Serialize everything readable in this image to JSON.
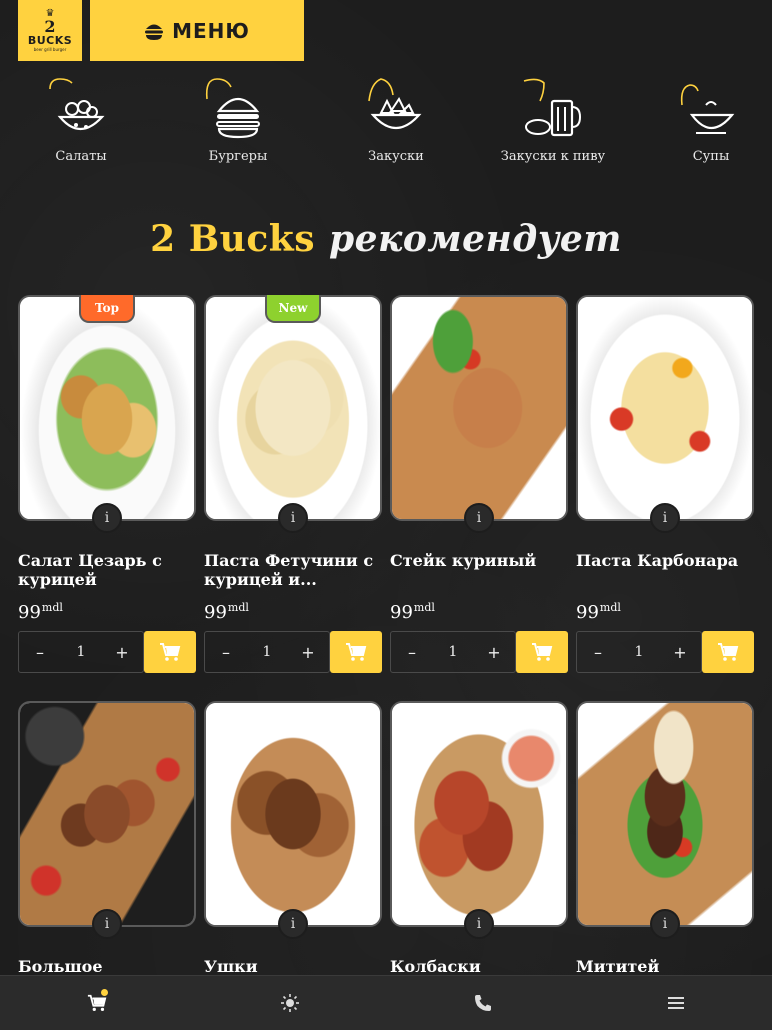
{
  "header": {
    "logo": {
      "line1": "2",
      "line2": "BUCKS",
      "line3": "beer grill burger"
    },
    "menu_label": "МЕНЮ"
  },
  "categories": [
    {
      "label": "Салаты",
      "icon": "salad-bowl-icon"
    },
    {
      "label": "Бургеры",
      "icon": "burger-icon"
    },
    {
      "label": "Закуски",
      "icon": "snacks-bowl-icon"
    },
    {
      "label": "Закуски к пиву",
      "icon": "beer-snacks-icon"
    },
    {
      "label": "Супы",
      "icon": "soup-bowl-icon"
    }
  ],
  "section": {
    "brand": "2 Bucks",
    "title": "рекомендует"
  },
  "products": [
    {
      "name": "Салат Цезарь с курицей",
      "price": "99",
      "currency": "mdl",
      "qty": "1",
      "badge": "Top"
    },
    {
      "name": "Паста Фетучини с курицей и...",
      "price": "99",
      "currency": "mdl",
      "qty": "1",
      "badge": "New"
    },
    {
      "name": "Стейк куриный",
      "price": "99",
      "currency": "mdl",
      "qty": "1",
      "badge": ""
    },
    {
      "name": "Паста Карбонара",
      "price": "99",
      "currency": "mdl",
      "qty": "1",
      "badge": ""
    },
    {
      "name": "Большое",
      "price": "",
      "currency": "",
      "qty": "",
      "badge": ""
    },
    {
      "name": "Ушки",
      "price": "",
      "currency": "",
      "qty": "",
      "badge": ""
    },
    {
      "name": "Колбаски",
      "price": "",
      "currency": "",
      "qty": "",
      "badge": ""
    },
    {
      "name": "Мититей",
      "price": "",
      "currency": "",
      "qty": "",
      "badge": ""
    }
  ],
  "controls": {
    "minus": "–",
    "plus": "+",
    "info": "i"
  },
  "bottom_nav": [
    {
      "icon": "cart-icon",
      "has_badge": true
    },
    {
      "icon": "sun-icon"
    },
    {
      "icon": "phone-icon"
    },
    {
      "icon": "hamburger-menu-icon"
    }
  ],
  "colors": {
    "accent": "#ffd23f",
    "background": "#1d1d1d",
    "badge_top": "#ff6a2a",
    "badge_new": "#8ed12e"
  }
}
